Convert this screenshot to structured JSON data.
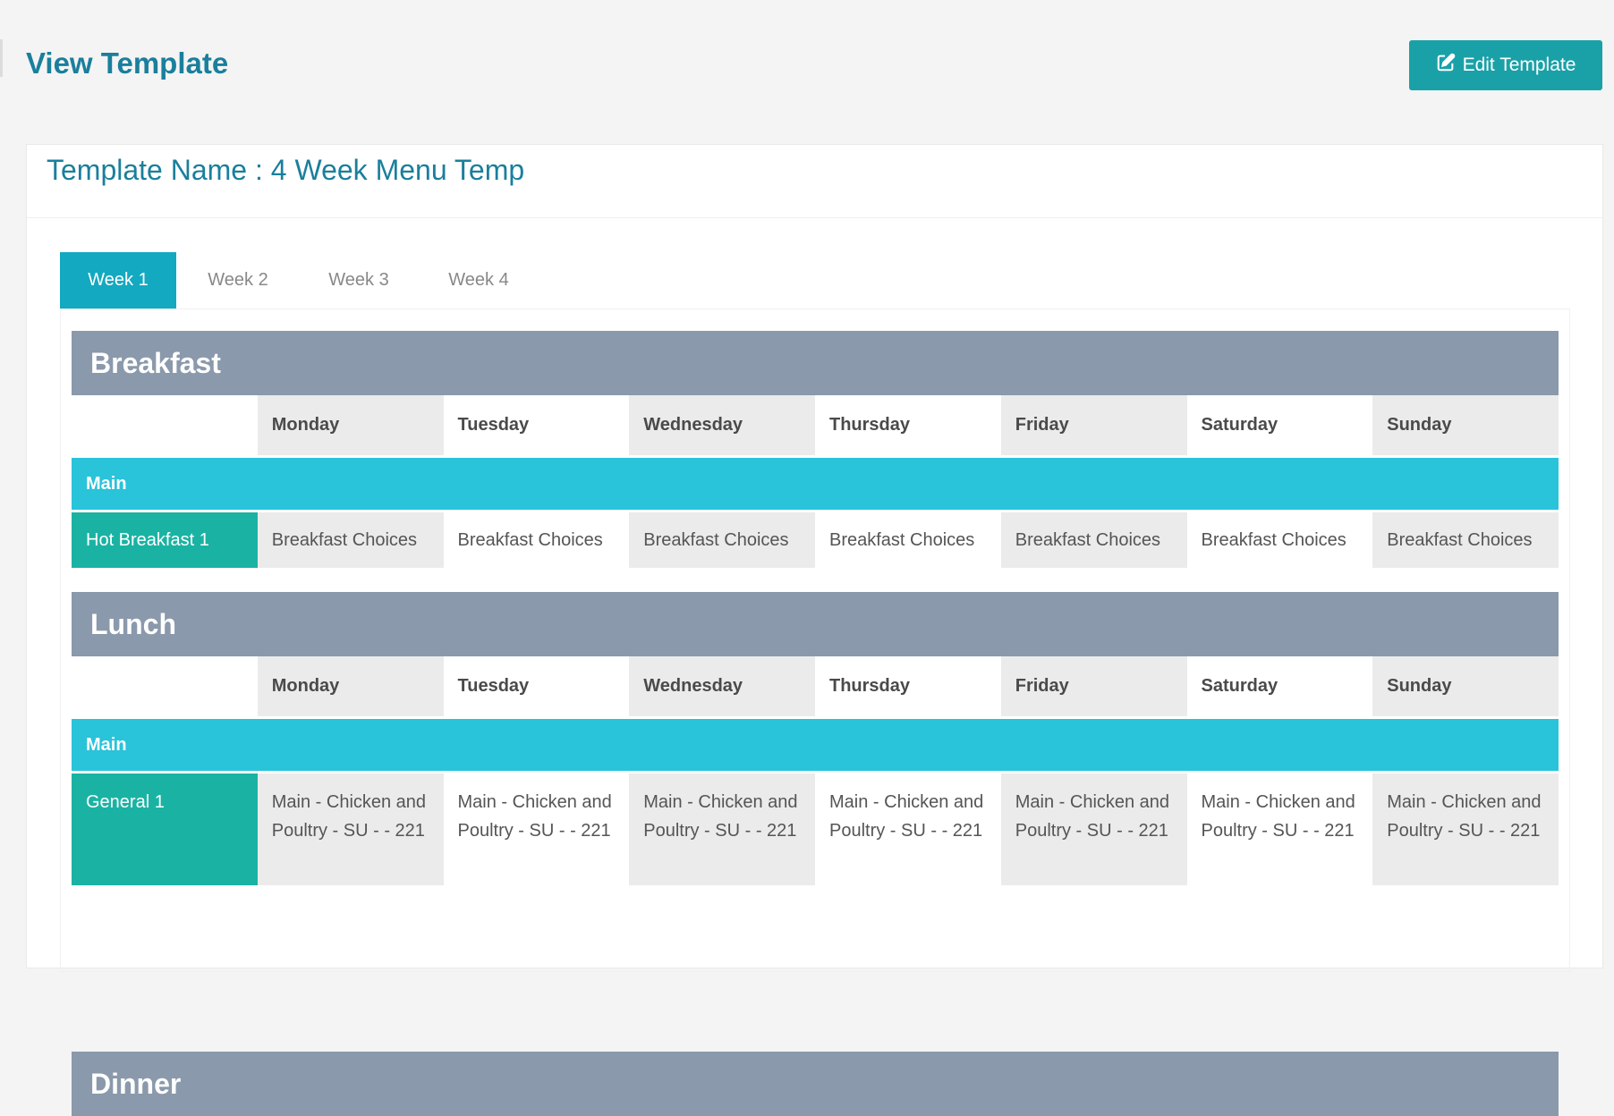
{
  "page": {
    "title": "View Template"
  },
  "edit_button": {
    "label": "Edit Template",
    "icon": "edit-icon"
  },
  "template": {
    "name_label": "Template Name : 4 Week Menu Temp"
  },
  "tabs": [
    {
      "label": "Week 1",
      "active": true
    },
    {
      "label": "Week 2",
      "active": false
    },
    {
      "label": "Week 3",
      "active": false
    },
    {
      "label": "Week 4",
      "active": false
    }
  ],
  "days": [
    "Monday",
    "Tuesday",
    "Wednesday",
    "Thursday",
    "Friday",
    "Saturday",
    "Sunday"
  ],
  "breakfast": {
    "title": "Breakfast",
    "section": "Main",
    "item_label": "Hot Breakfast 1",
    "values": [
      "Breakfast Choices",
      "Breakfast Choices",
      "Breakfast Choices",
      "Breakfast Choices",
      "Breakfast Choices",
      "Breakfast Choices",
      "Breakfast Choices"
    ]
  },
  "lunch": {
    "title": "Lunch",
    "section": "Main",
    "item_label": "General 1",
    "values": [
      "Main - Chicken and Poultry - SU - - 221",
      "Main - Chicken and Poultry - SU - - 221",
      "Main - Chicken and Poultry - SU - - 221",
      "Main - Chicken and Poultry - SU - - 221",
      "Main - Chicken and Poultry - SU - - 221",
      "Main - Chicken and Poultry - SU - - 221",
      "Main - Chicken and Poultry - SU - - 221"
    ]
  },
  "dinner": {
    "title": "Dinner"
  },
  "colors": {
    "accent": "#1aa1a8",
    "title": "#1a7f9c",
    "meal_header": "#8a99ab",
    "section": "#29c3da",
    "item_label": "#1ab3a3"
  }
}
